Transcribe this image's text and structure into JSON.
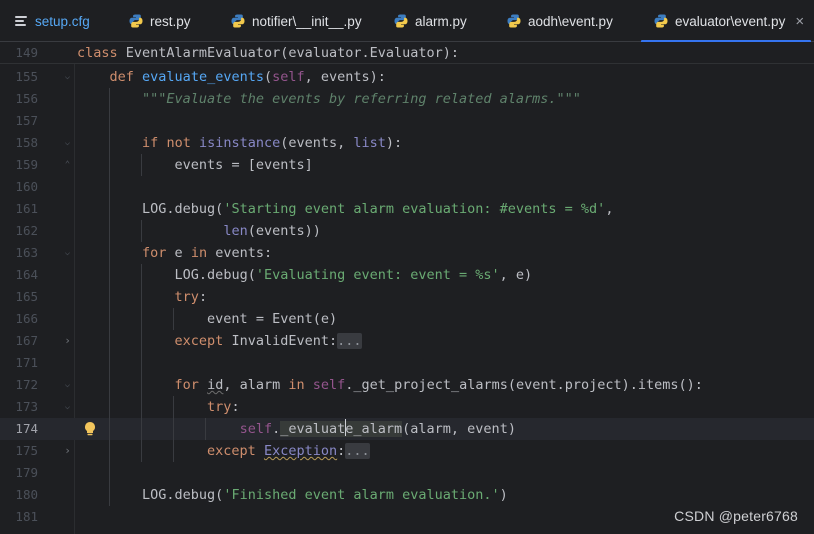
{
  "tabs": [
    {
      "label": "setup.cfg",
      "icon": "config-file-icon"
    },
    {
      "label": "rest.py",
      "icon": "python-file-icon"
    },
    {
      "label": "notifier\\__init__.py",
      "icon": "python-file-icon"
    },
    {
      "label": "alarm.py",
      "icon": "python-file-icon"
    },
    {
      "label": "aodh\\event.py",
      "icon": "python-file-icon"
    },
    {
      "label": "evaluator\\event.py",
      "icon": "python-file-icon",
      "active": true
    }
  ],
  "close_symbol": "×",
  "sticky_line": {
    "number": "149",
    "text": "class EventAlarmEvaluator(evaluator.Evaluator):"
  },
  "line_numbers": [
    "155",
    "156",
    "157",
    "158",
    "159",
    "160",
    "161",
    "162",
    "163",
    "164",
    "165",
    "166",
    "167",
    "171",
    "172",
    "173",
    "174",
    "175",
    "179",
    "180",
    "181"
  ],
  "current_line": "174",
  "code": {
    "l155_def": "def",
    "l155_name": "evaluate_events",
    "l155_self": "self",
    "l155_rest": ", events):",
    "l156_doc": "\"\"\"Evaluate the events by referring related alarms.\"\"\"",
    "l158_if": "if",
    "l158_not": "not",
    "l158_isinstance": "isinstance",
    "l158_mid": "(events, ",
    "l158_list": "list",
    "l158_end": "):",
    "l159": "events = [events]",
    "l161_pre": "LOG.debug(",
    "l161_str": "'Starting event alarm evaluation: #events = %d'",
    "l161_end": ",",
    "l162_len": "len",
    "l162_rest": "(events))",
    "l163_for": "for",
    "l163_mid": " e ",
    "l163_in": "in",
    "l163_rest": " events:",
    "l164_pre": "LOG.debug(",
    "l164_str": "'Evaluating event: event = %s'",
    "l164_end": ", e)",
    "l165_try": "try",
    "l165_colon": ":",
    "l166": "event = Event(e)",
    "l167_except": "except",
    "l167_cls": " InvalidEvent:",
    "l167_fold": "...",
    "l172_for": "for",
    "l172_id": "id",
    "l172_mid": ", alarm ",
    "l172_in": "in",
    "l172_self": "self",
    "l172_rest": "._get_project_alarms(event.project).items():",
    "l173_try": "try",
    "l173_colon": ":",
    "l174_self": "self",
    "l174_dot": ".",
    "l174_a": "_evaluat",
    "l174_b": "e_alarm",
    "l174_rest": "(alarm, event)",
    "l175_except": "except",
    "l175_exc": "Exception",
    "l175_colon": ":",
    "l175_fold": "...",
    "l180_pre": "LOG.debug(",
    "l180_str": "'Finished event alarm evaluation.'",
    "l180_end": ")"
  },
  "watermark": "CSDN @peter6768",
  "colors": {
    "background": "#1e1f22",
    "keyword": "#cf8e6d",
    "function": "#56a8f5",
    "self": "#94558d",
    "builtin": "#8888c6",
    "string": "#6aab73",
    "docstring": "#5f826b",
    "active_tab_underline": "#3574f0"
  }
}
